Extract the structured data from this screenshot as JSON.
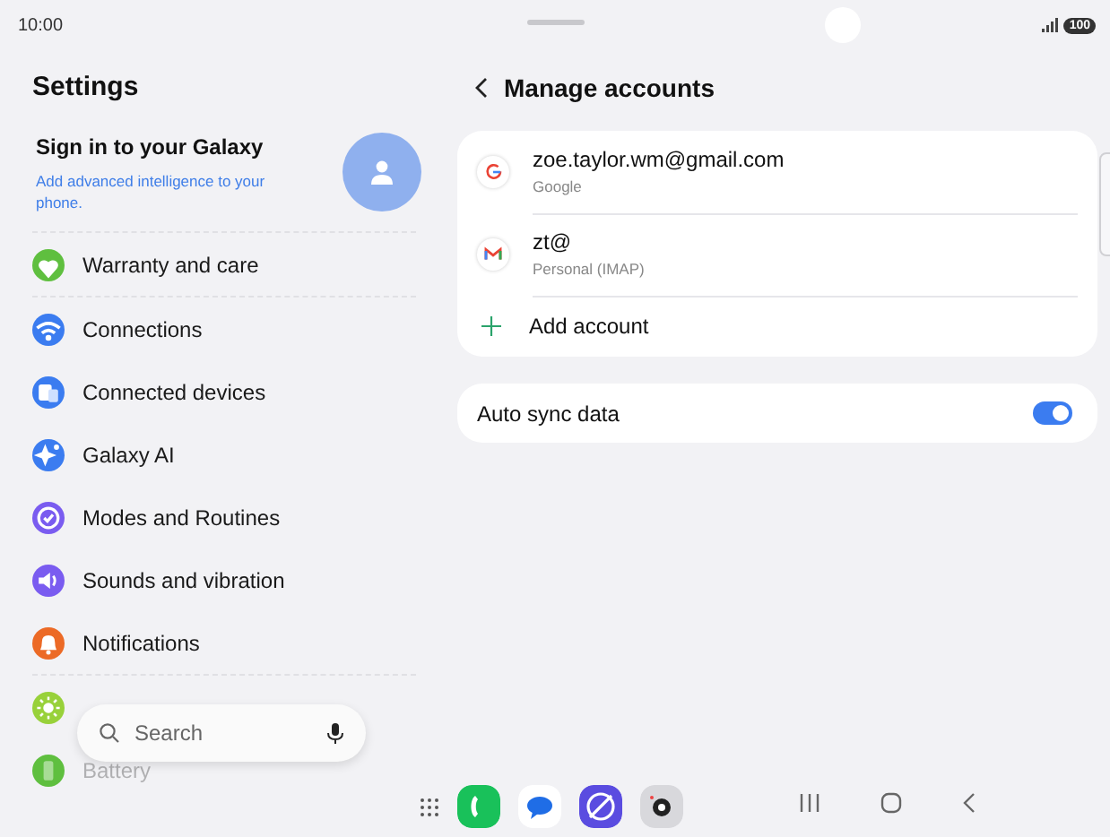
{
  "status_bar": {
    "time": "10:00",
    "battery": "100"
  },
  "settings": {
    "title": "Settings",
    "sign_in": {
      "title": "Sign in to your Galaxy",
      "subtitle": "Add advanced intelligence to your phone."
    },
    "groups": [
      [
        {
          "label": "Warranty and care",
          "kind": "heart",
          "color": "#5fbf3f",
          "dimmed": false
        }
      ],
      [
        {
          "label": "Connections",
          "kind": "wifi",
          "color": "#3b7cf0",
          "dimmed": false
        },
        {
          "label": "Connected devices",
          "kind": "devices",
          "color": "#3b7cf0",
          "dimmed": false
        },
        {
          "label": "Galaxy AI",
          "kind": "sparkle",
          "color": "#3b7cf0",
          "dimmed": false
        },
        {
          "label": "Modes and Routines",
          "kind": "check",
          "color": "#7a5cf0",
          "dimmed": false
        },
        {
          "label": "Sounds and vibration",
          "kind": "speaker",
          "color": "#7a5cf0",
          "dimmed": false
        },
        {
          "label": "Notifications",
          "kind": "bell",
          "color": "#ec6a26",
          "dimmed": false
        }
      ],
      [
        {
          "kind": "sun",
          "color": "#98d13a",
          "dimmed": false
        },
        {
          "label": "Battery",
          "kind": "battery",
          "color": "#5fbf3f",
          "dimmed": true
        }
      ]
    ]
  },
  "search": {
    "placeholder": "Search"
  },
  "accounts": {
    "title": "Manage accounts",
    "items": [
      {
        "kind": "google",
        "name": "zoe.taylor.wm@gmail.com",
        "type": "Google"
      },
      {
        "kind": "gmail",
        "name": "zt@",
        "type": "Personal (IMAP)"
      }
    ],
    "add_label": "Add account"
  },
  "sync": {
    "label": "Auto sync data",
    "on": true
  }
}
